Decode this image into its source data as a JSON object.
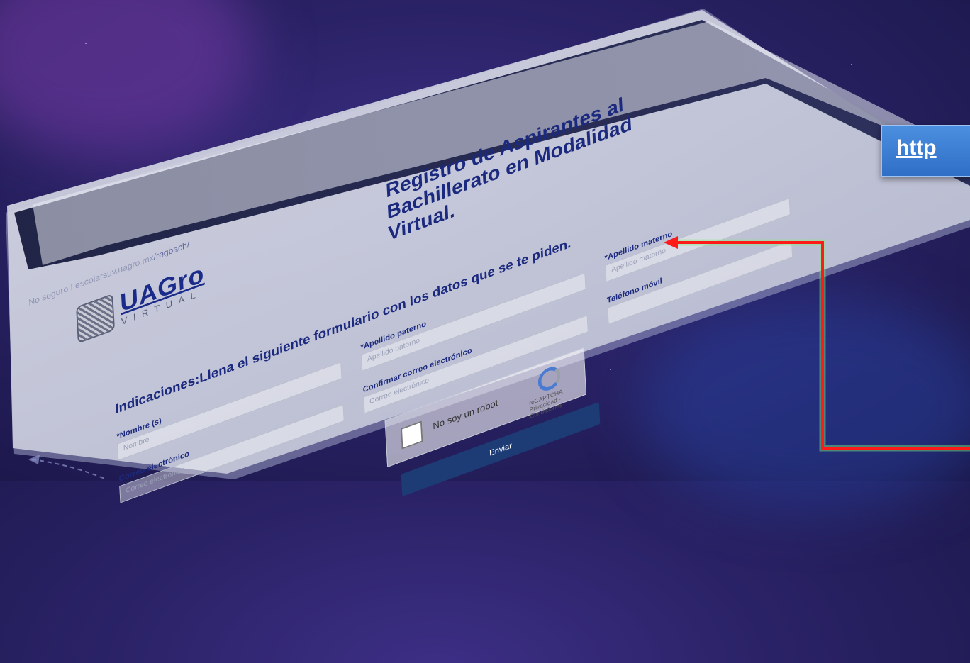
{
  "browser": {
    "security_label": "No seguro",
    "separator": "|",
    "host": "escolarsuv.uagro.mx",
    "path": "/regbach/"
  },
  "header": {
    "logo_text": "UAGro",
    "logo_sub": "VIRTUAL",
    "title_line1": "Registro de Aspirantes al",
    "title_line2": "Bachillerato en Modalidad Virtual."
  },
  "form": {
    "instructions": "Indicaciones:Llena el siguiente formulario con los datos que se te piden.",
    "fields": {
      "nombre": {
        "label": "*Nombre (s)",
        "placeholder": "Nombre"
      },
      "apellido_paterno": {
        "label": "*Apellido paterno",
        "placeholder": "Apellido paterno"
      },
      "apellido_materno": {
        "label": "*Apellido materno",
        "placeholder": "Apellido materno"
      },
      "correo": {
        "label": "Correo electrónico",
        "placeholder": "Correo electrónico"
      },
      "confirmar_correo": {
        "label": "Confirmar correo electrónico",
        "placeholder": "Correo electrónico"
      },
      "telefono": {
        "label": "Teléfono móvil",
        "placeholder": ""
      }
    },
    "captcha": {
      "checkbox_label": "No soy un robot",
      "brand": "reCAPTCHA",
      "links": "Privacidad - Condiciones"
    },
    "submit_label": "Enviar"
  },
  "link_chip": {
    "label": "http"
  },
  "colors": {
    "background": "#2a2266",
    "title": "#1b2a7e",
    "submit": "#1d3b75",
    "pointer": "#ff1a1a",
    "chip": "#3d80d4"
  }
}
